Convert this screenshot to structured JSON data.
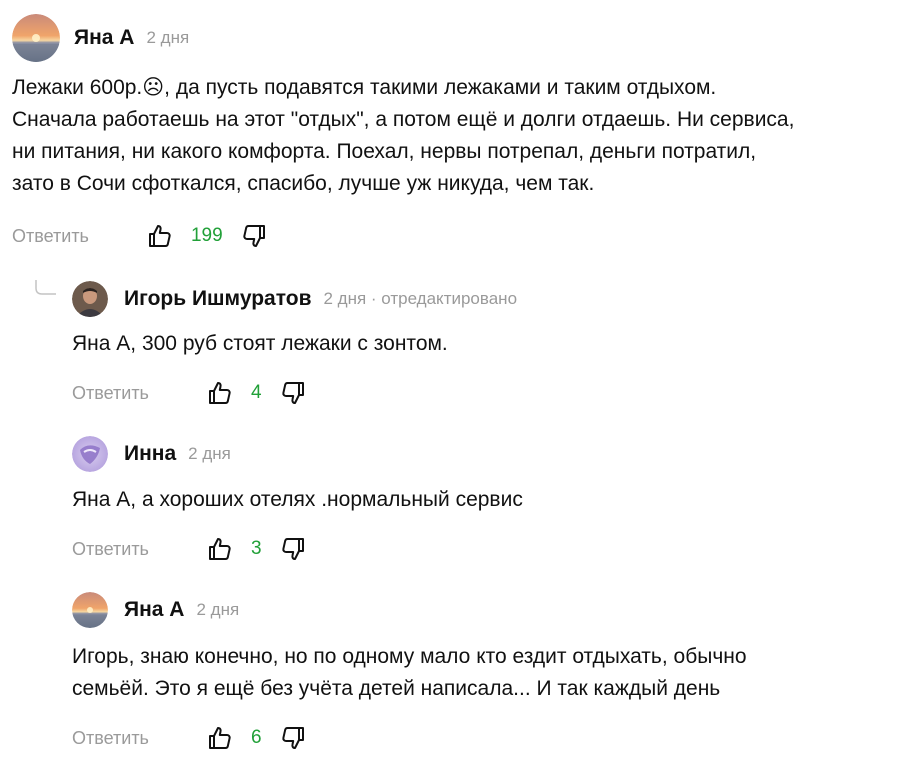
{
  "comments": [
    {
      "author": "Яна А",
      "time": "2 дня",
      "lines": [
        "Лежаки 600р.☹, да пусть подавятся такими лежаками и таким отдыхом.",
        "Сначала работаешь на этот \"отдых\", а потом ещё и долги отдаешь. Ни сервиса,",
        "ни питания, ни какого комфорта. Поехал, нервы потрепал, деньги потратил,",
        "зато в Сочи сфоткался, спасибо, лучше уж никуда, чем так."
      ],
      "reply_label": "Ответить",
      "likes": "199",
      "avatar": "sunset"
    },
    {
      "author": "Игорь Ишмуратов",
      "time": "2 дня · отредактировано",
      "lines": [
        "Яна А, 300 руб стоят лежаки с зонтом."
      ],
      "reply_label": "Ответить",
      "likes": "4",
      "avatar": "photo"
    },
    {
      "author": "Инна",
      "time": "2 дня",
      "lines": [
        "Яна А, а хороших отелях .нормальный сервис"
      ],
      "reply_label": "Ответить",
      "likes": "3",
      "avatar": "purple"
    },
    {
      "author": "Яна А",
      "time": "2 дня",
      "lines": [
        "Игорь, знаю конечно, но по одному мало кто ездит отдыхать, обычно",
        "семьёй. Это я ещё без учёта детей написала... И так каждый день"
      ],
      "reply_label": "Ответить",
      "likes": "6",
      "avatar": "sunset"
    }
  ],
  "colors": {
    "like_count": "#21a038",
    "meta": "#9a9a9a",
    "text": "#111111"
  },
  "icons": [
    "thumbs-up-icon",
    "thumbs-down-icon",
    "reply-thread-icon"
  ]
}
